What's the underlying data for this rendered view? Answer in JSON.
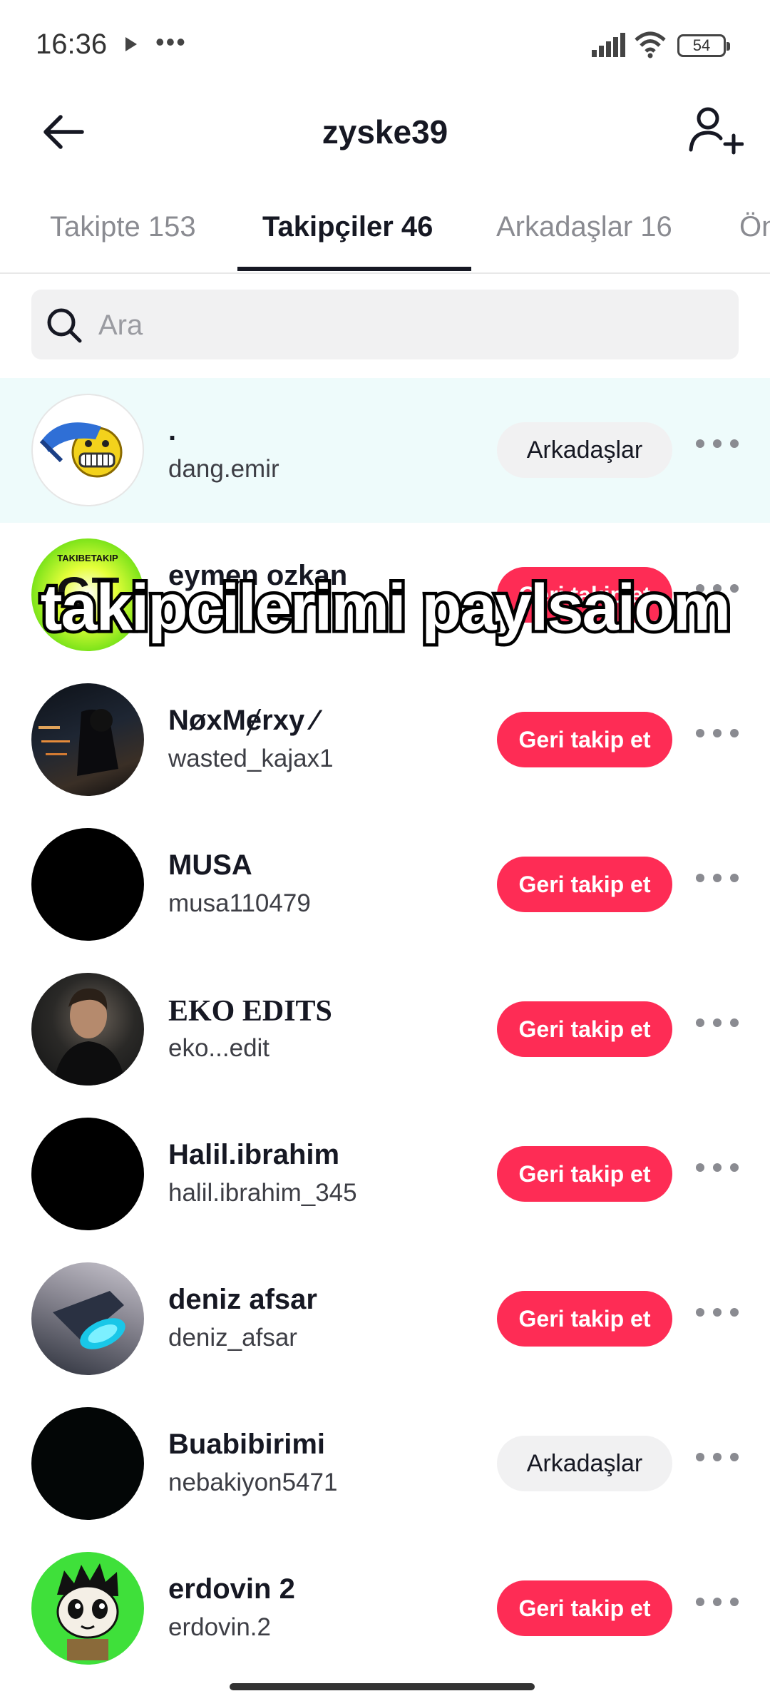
{
  "status_bar": {
    "time": "16:36",
    "dots": "•••",
    "battery": "54"
  },
  "header": {
    "title": "zyske39",
    "back_icon": "back-arrow-icon",
    "add_friend_icon": "add-user-icon"
  },
  "tabs": [
    {
      "label": "Takipte 153"
    },
    {
      "label": "Takipçiler 46",
      "active": true
    },
    {
      "label": "Arkadaşlar 16"
    },
    {
      "label": "Ön"
    }
  ],
  "search": {
    "placeholder": "Ara",
    "value": ""
  },
  "followers": [
    {
      "nickname": ".",
      "username": "dang.emir",
      "button": "Arkadaşlar",
      "button_style": "grey"
    },
    {
      "nickname": "eymen ozkan",
      "username": "",
      "button": "Geri takip et",
      "button_style": "red"
    },
    {
      "nickname": "NøxMɇrxy ⁄",
      "username": "wasted_kajax1",
      "button": "Geri takip et",
      "button_style": "red"
    },
    {
      "nickname": "MUSA",
      "username": "musa110479",
      "button": "Geri takip et",
      "button_style": "red"
    },
    {
      "nickname": "EKO EDITS",
      "username": "eko...edit",
      "button": "Geri takip et",
      "button_style": "red"
    },
    {
      "nickname": "Halil.ibrahim",
      "username": "halil.ibrahim_345",
      "button": "Geri takip et",
      "button_style": "red"
    },
    {
      "nickname": "deniz afsar",
      "username": "deniz_afsar",
      "button": "Geri takip et",
      "button_style": "red"
    },
    {
      "nickname": "Buabibirimi",
      "username": "nebakiyon5471",
      "button": "Arkadaşlar",
      "button_style": "grey"
    },
    {
      "nickname": "erdovin 2",
      "username": "erdovin.2",
      "button": "Geri takip et",
      "button_style": "red"
    }
  ],
  "avatar_badge": {
    "top_text": "TAKIBETAKIP",
    "mid_text": "GT",
    "bottom_text": "GERITAKIP"
  },
  "overlay_caption": "takipcilerimi paylsaiom",
  "colors": {
    "accent_red": "#fe2c55",
    "highlight_row": "#eefbfb",
    "grey_button": "#f1f1f2"
  }
}
